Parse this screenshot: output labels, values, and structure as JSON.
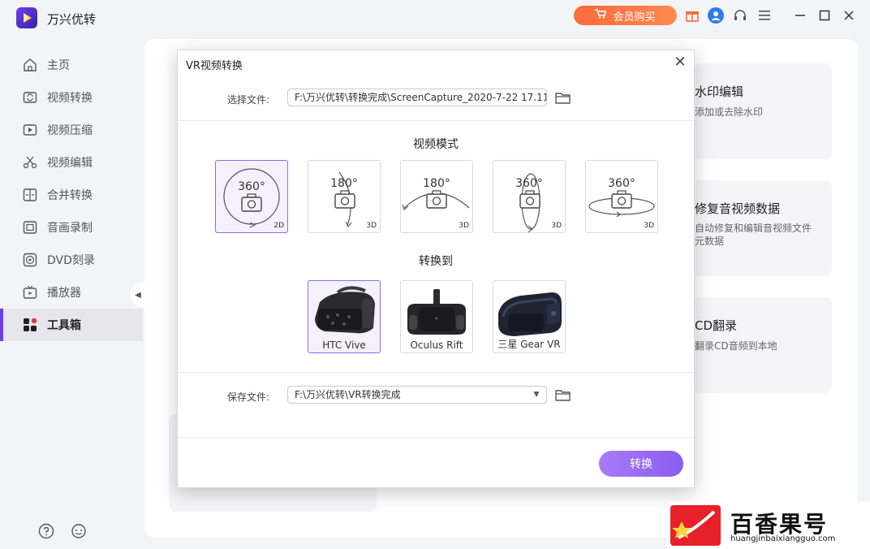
{
  "app": {
    "name": "万兴优转"
  },
  "titlebar": {
    "vip_label": "会员购买"
  },
  "sidebar": {
    "items": [
      {
        "label": "主页",
        "icon": "home-icon"
      },
      {
        "label": "视频转换",
        "icon": "convert-icon"
      },
      {
        "label": "视频压缩",
        "icon": "compress-icon"
      },
      {
        "label": "视频编辑",
        "icon": "scissors-icon"
      },
      {
        "label": "合并转换",
        "icon": "merge-icon"
      },
      {
        "label": "音画录制",
        "icon": "record-icon"
      },
      {
        "label": "DVD刻录",
        "icon": "disc-icon"
      },
      {
        "label": "播放器",
        "icon": "player-icon"
      },
      {
        "label": "工具箱",
        "icon": "toolbox-icon",
        "active": true
      }
    ]
  },
  "background_cards": [
    {
      "title": "水印编辑",
      "desc": "添加或去除水印"
    },
    {
      "title": "修复音视频数据",
      "desc": "自动修复和编辑音视频文件元数据"
    },
    {
      "title": "CD翻录",
      "desc": "翻录CD音频到本地"
    }
  ],
  "dialog": {
    "title": "VR视频转换",
    "select_file_label": "选择文件:",
    "select_file_value": "F:\\万兴优转\\转换完成\\ScreenCapture_2020-7-22 17.11.",
    "video_mode_title": "视频模式",
    "modes": [
      {
        "deg": "360°",
        "dim": "2D",
        "selected": true
      },
      {
        "deg": "180°",
        "dim": "3D"
      },
      {
        "deg": "180°",
        "dim": "3D"
      },
      {
        "deg": "360°",
        "dim": "3D"
      },
      {
        "deg": "360°",
        "dim": "3D"
      }
    ],
    "convert_to_title": "转换到",
    "devices": [
      {
        "label": "HTC Vive",
        "selected": true
      },
      {
        "label": "Oculus Rift"
      },
      {
        "label": "三星 Gear VR"
      }
    ],
    "save_file_label": "保存文件:",
    "save_file_value": "F:\\万兴优转\\VR转换完成",
    "convert_label": "转换"
  },
  "watermark": {
    "text": "百香果号",
    "url": "huangjinbaixiangguo.com"
  },
  "colors": {
    "accent": "#8b5cf0",
    "vip": "#ff6a3d",
    "selected_border": "#8b6cf2"
  }
}
